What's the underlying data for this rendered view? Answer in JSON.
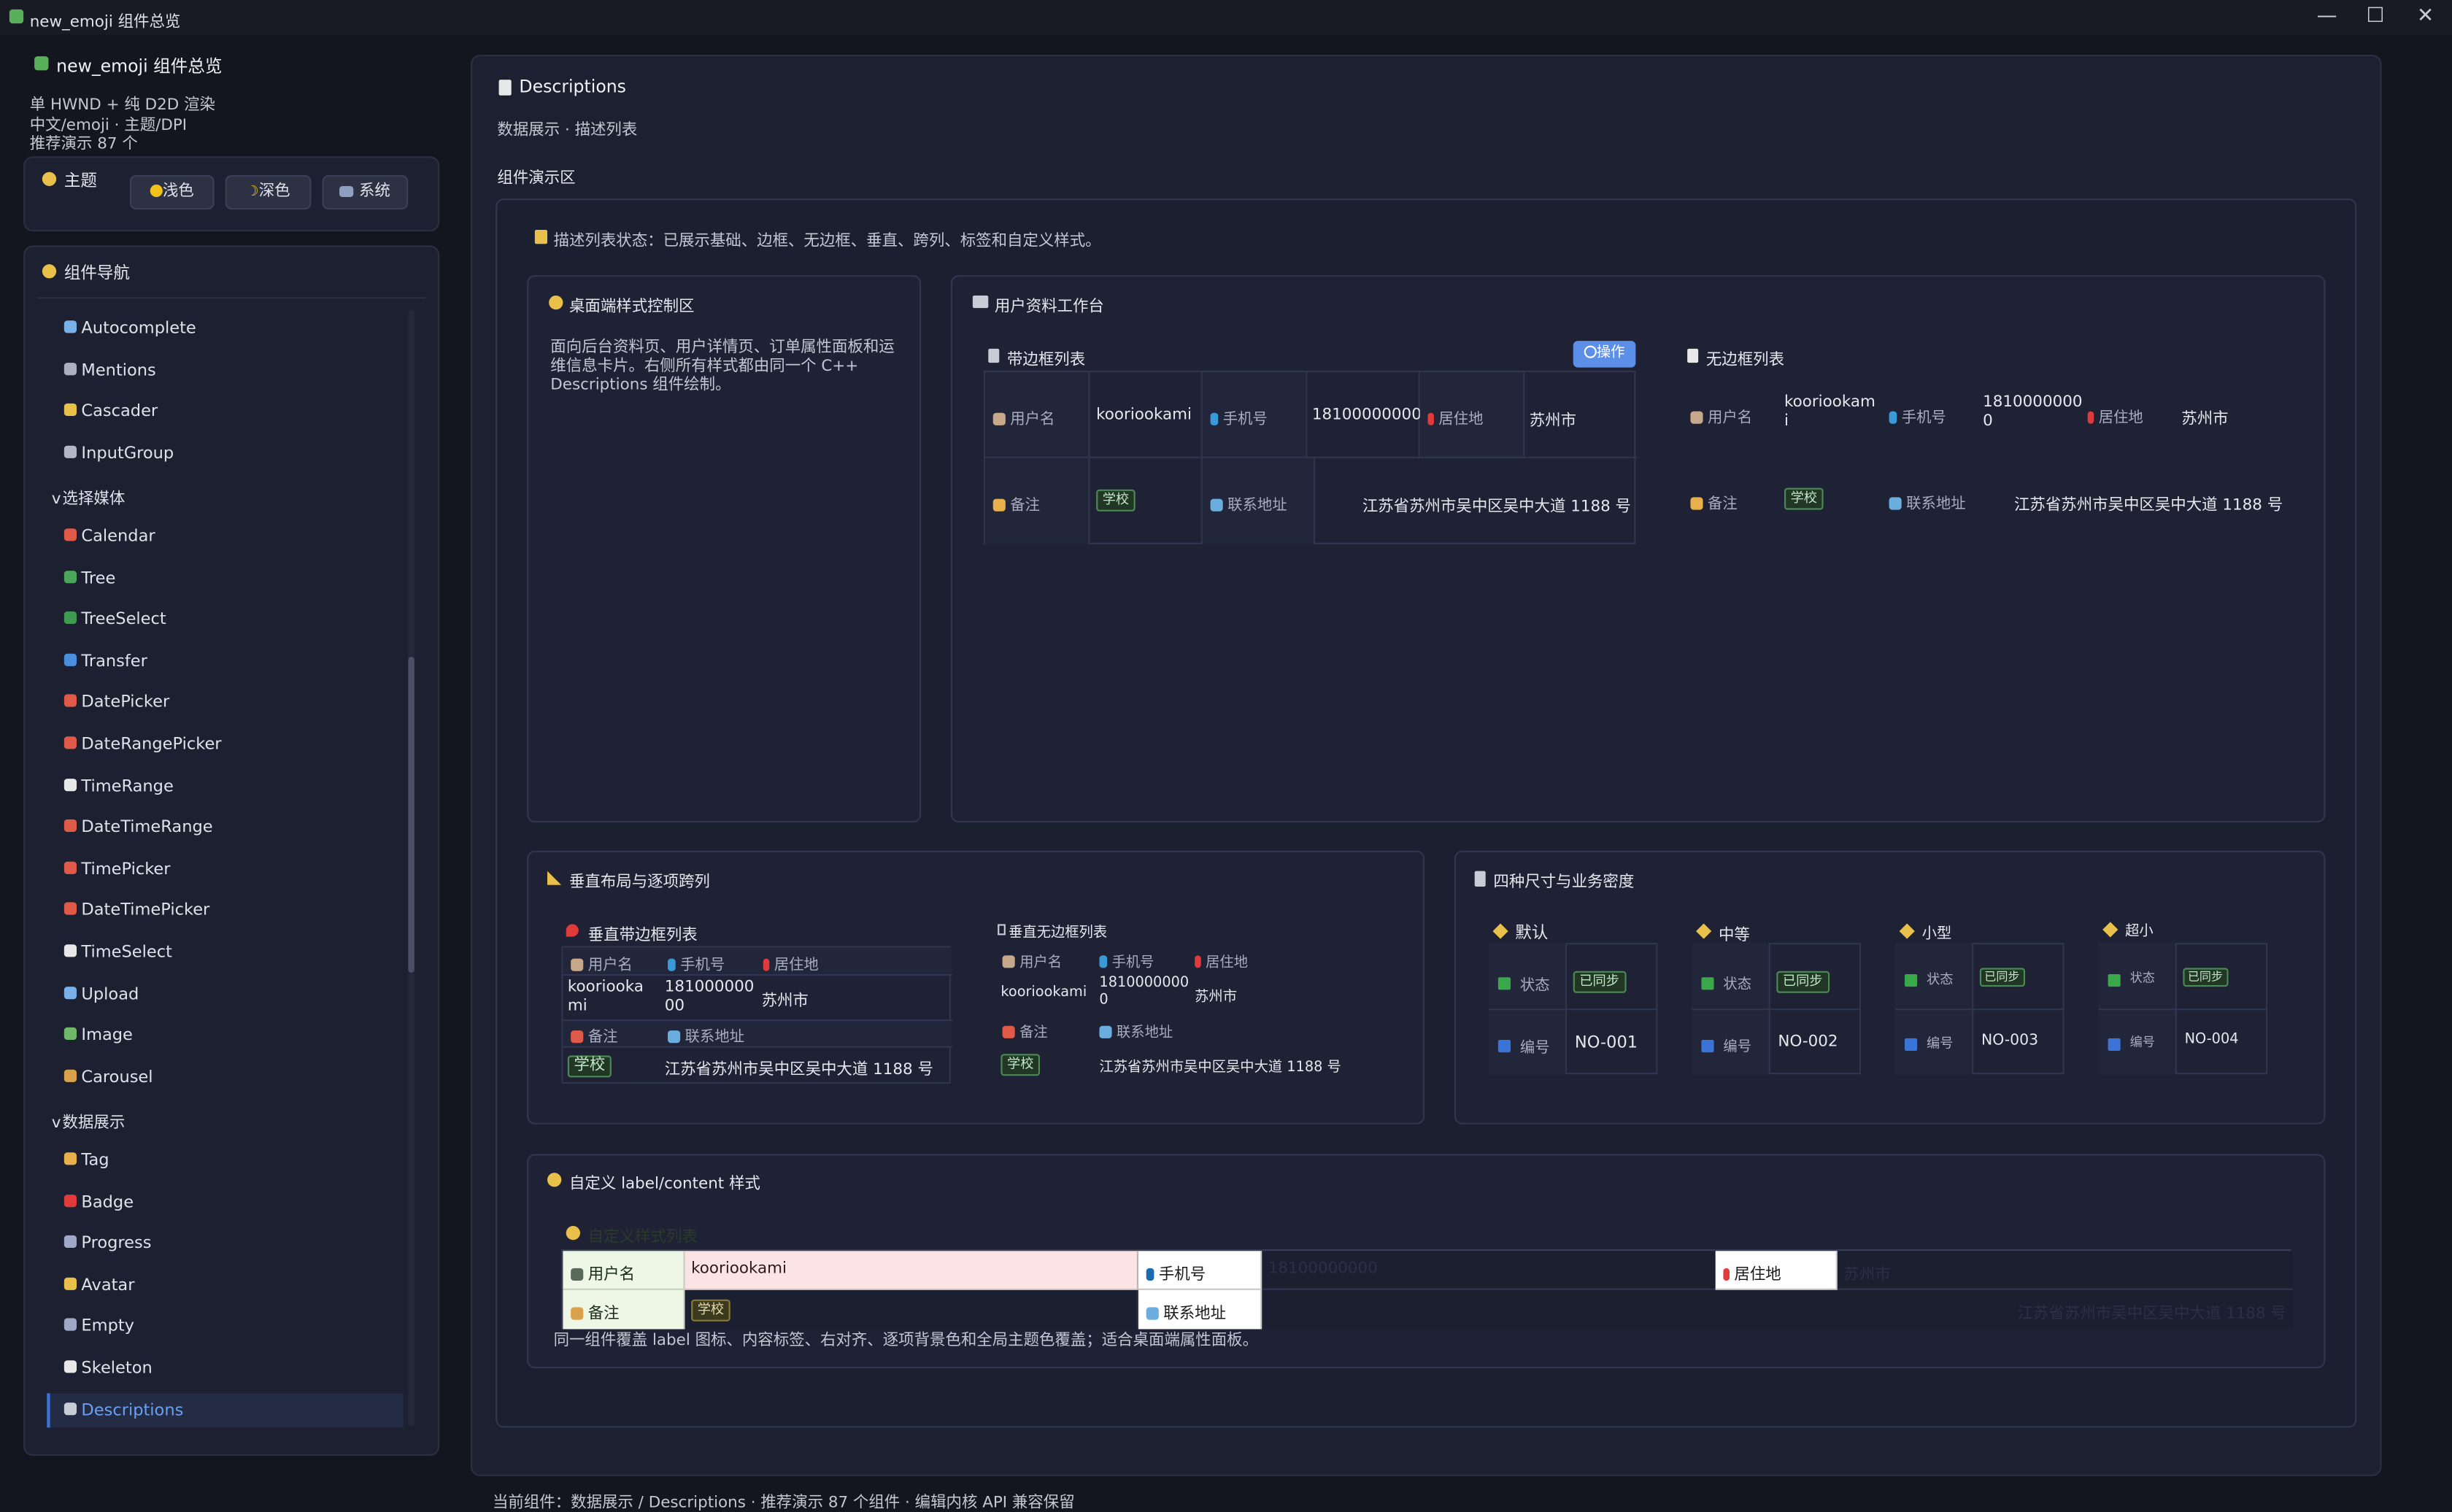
{
  "window": {
    "title": "new_emoji 组件总览"
  },
  "sidebar": {
    "app_title": "new_emoji 组件总览",
    "info": [
      "单 HWND + 纯 D2D 渲染",
      "中文/emoji · 主题/DPI",
      "推荐演示 87 个"
    ],
    "theme": {
      "label": "主题",
      "light": "浅色",
      "dark": "深色",
      "system": "系统"
    },
    "nav_title": "组件导航",
    "items": [
      {
        "label": "Autocomplete",
        "icon": "magnifier-icon",
        "color": "#7ab0e8"
      },
      {
        "label": "Mentions",
        "icon": "at-icon",
        "color": "#aab0c0"
      },
      {
        "label": "Cascader",
        "icon": "compass-icon",
        "color": "#e8c04a"
      },
      {
        "label": "InputGroup",
        "icon": "link-icon",
        "color": "#b0b8c8"
      },
      {
        "label": "选择媒体",
        "icon": "folder-icon",
        "color": "#e8c04a",
        "group": true
      },
      {
        "label": "Calendar",
        "icon": "calendar-icon",
        "color": "#e05a4a"
      },
      {
        "label": "Tree",
        "icon": "tree-icon",
        "color": "#4aa65a"
      },
      {
        "label": "TreeSelect",
        "icon": "evergreen-icon",
        "color": "#3f9a52"
      },
      {
        "label": "Transfer",
        "icon": "swap-icon",
        "color": "#4a8ee0"
      },
      {
        "label": "DatePicker",
        "icon": "date-icon",
        "color": "#e05a4a"
      },
      {
        "label": "DateRangePicker",
        "icon": "calendar-icon",
        "color": "#e05a4a"
      },
      {
        "label": "TimeRange",
        "icon": "clock-icon",
        "color": "#e8e8e8"
      },
      {
        "label": "DateTimeRange",
        "icon": "calendar-icon",
        "color": "#e05a4a"
      },
      {
        "label": "TimePicker",
        "icon": "alarm-clock-icon",
        "color": "#e05a4a"
      },
      {
        "label": "DateTimePicker",
        "icon": "calendar-icon",
        "color": "#e05a4a"
      },
      {
        "label": "TimeSelect",
        "icon": "clock-icon",
        "color": "#e8e8e8"
      },
      {
        "label": "Upload",
        "icon": "upload-icon",
        "color": "#7ab0e8"
      },
      {
        "label": "Image",
        "icon": "picture-icon",
        "color": "#6fb86a"
      },
      {
        "label": "Carousel",
        "icon": "carousel-icon",
        "color": "#d9a24a"
      },
      {
        "label": "数据展示",
        "icon": "folder-icon",
        "color": "#e8c04a",
        "group": true
      },
      {
        "label": "Tag",
        "icon": "tag-icon",
        "color": "#e8b04a"
      },
      {
        "label": "Badge",
        "icon": "red-circle-icon",
        "color": "#e03a3a"
      },
      {
        "label": "Progress",
        "icon": "chart-icon",
        "color": "#a0a8c8"
      },
      {
        "label": "Avatar",
        "icon": "smiley-icon",
        "color": "#e8c04a"
      },
      {
        "label": "Empty",
        "icon": "mailbox-icon",
        "color": "#a0a8c8"
      },
      {
        "label": "Skeleton",
        "icon": "skull-icon",
        "color": "#e8e8e8"
      },
      {
        "label": "Descriptions",
        "icon": "document-icon",
        "color": "#c8ccd6",
        "selected": true
      }
    ],
    "collapse_marker": "v"
  },
  "main": {
    "title": "Descriptions",
    "subtitle": "数据展示 · 描述列表",
    "section": "组件演示区",
    "status": "描述列表状态：已展示基础、边框、无边框、垂直、跨列、标签和自定义样式。",
    "desktop": {
      "title": "桌面端样式控制区",
      "body": "面向后台资料页、用户详情页、订单属性面板和运维信息卡片。右侧所有样式都由同一个 C++ Descriptions 组件绘制。"
    },
    "workspace": {
      "title": "用户资料工作台",
      "bordered_title": "带边框列表",
      "action": "操作",
      "borderless_title": "无边框列表",
      "username_label": "用户名",
      "username": "kooriookami",
      "phone_label": "手机号",
      "phone": "18100000000",
      "phone_wrap": [
        "1810000000",
        "0"
      ],
      "name_wrap": [
        "kooriookam",
        "i"
      ],
      "location_label": "居住地",
      "location": "苏州市",
      "remark_label": "备注",
      "remark_tag": "学校",
      "address_label": "联系地址",
      "address": "江苏省苏州市吴中区吴中大道 1188 号"
    },
    "vertical": {
      "title": "垂直布局与逐项跨列",
      "bordered_title": "垂直带边框列表",
      "borderless_title": "垂直无边框列表",
      "name_wrap": [
        "kooriooka",
        "mi"
      ],
      "phone_wrap": [
        "181000000",
        "00"
      ]
    },
    "sizes": {
      "title": "四种尺寸与业务密度",
      "columns": [
        {
          "name": "默认",
          "status_label": "状态",
          "status": "已同步",
          "id_label": "编号",
          "id": "NO-001"
        },
        {
          "name": "中等",
          "status_label": "状态",
          "status": "已同步",
          "id_label": "编号",
          "id": "NO-002"
        },
        {
          "name": "小型",
          "status_label": "状态",
          "status": "已同步",
          "id_label": "编号",
          "id": "NO-003"
        },
        {
          "name": "超小",
          "status_label": "状态",
          "status": "已同步",
          "id_label": "编号",
          "id": "NO-004"
        }
      ]
    },
    "custom": {
      "title": "自定义 label/content 样式",
      "list_title": "自定义样式列表",
      "note": "同一组件覆盖 label 图标、内容标签、右对齐、逐项背景色和全局主题色覆盖；适合桌面端属性面板。"
    },
    "footer": "当前组件：数据展示 / Descriptions · 推荐演示 87 个组件 · 编辑内核 API 兼容保留"
  },
  "colors": {
    "accent": "#2f6fd6",
    "custom_label_bg": "#eef7e6",
    "custom_content_bg": "#fde4e4",
    "tag_green": "#4c8a53"
  }
}
